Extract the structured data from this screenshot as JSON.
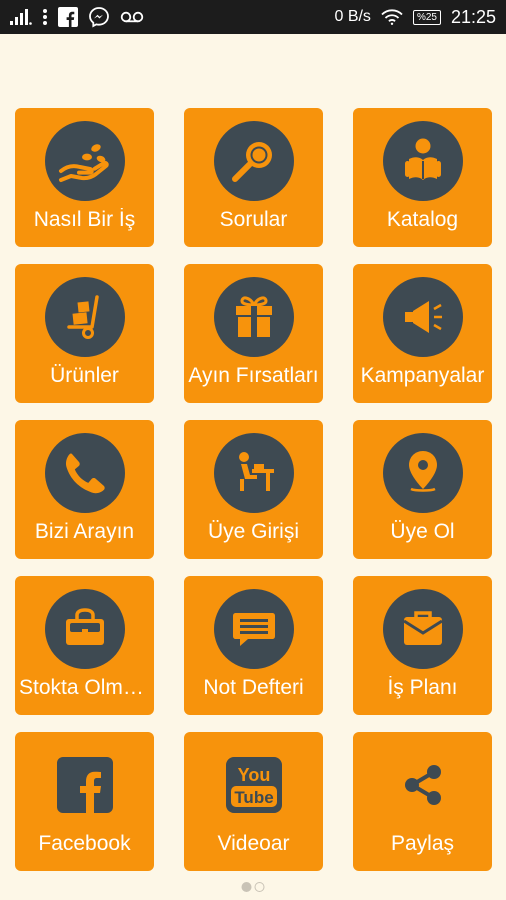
{
  "status_bar": {
    "net_speed": "0 B/s",
    "battery": "%25",
    "time": "21:25",
    "icons_left": [
      "signal-icon",
      "menu-dots-icon",
      "facebook-icon",
      "messenger-icon",
      "voicemail-icon"
    ],
    "icons_right": [
      "wifi-icon",
      "battery-icon"
    ]
  },
  "colors": {
    "tile": "#f7930c",
    "icon_circle": "#3e4a52",
    "background": "#fdf7e7",
    "status_bar": "#1c1c1c"
  },
  "tiles": [
    {
      "label": "Nasıl Bir İş",
      "icon": "hand-coins-icon"
    },
    {
      "label": "Sorular",
      "icon": "magnifier-icon"
    },
    {
      "label": "Katalog",
      "icon": "reader-book-icon"
    },
    {
      "label": "Ürünler",
      "icon": "hand-truck-icon"
    },
    {
      "label": "Ayın Fırsatları",
      "icon": "gift-box-icon"
    },
    {
      "label": "Kampanyalar",
      "icon": "megaphone-icon"
    },
    {
      "label": "Bizi Arayın",
      "icon": "phone-icon"
    },
    {
      "label": "Üye Girişi",
      "icon": "person-desk-icon"
    },
    {
      "label": "Üye Ol",
      "icon": "map-pin-icon"
    },
    {
      "label": "Stokta Olmayanlar",
      "icon": "bag-icon"
    },
    {
      "label": "Not Defteri",
      "icon": "chat-bubble-icon"
    },
    {
      "label": "İş Planı",
      "icon": "briefcase-icon"
    },
    {
      "label": "Facebook",
      "icon": "facebook-square-icon"
    },
    {
      "label": "Videoar",
      "icon": "youtube-icon"
    },
    {
      "label": "Paylaş",
      "icon": "share-icon"
    }
  ],
  "pagination": {
    "pages": 2,
    "current": 1
  }
}
